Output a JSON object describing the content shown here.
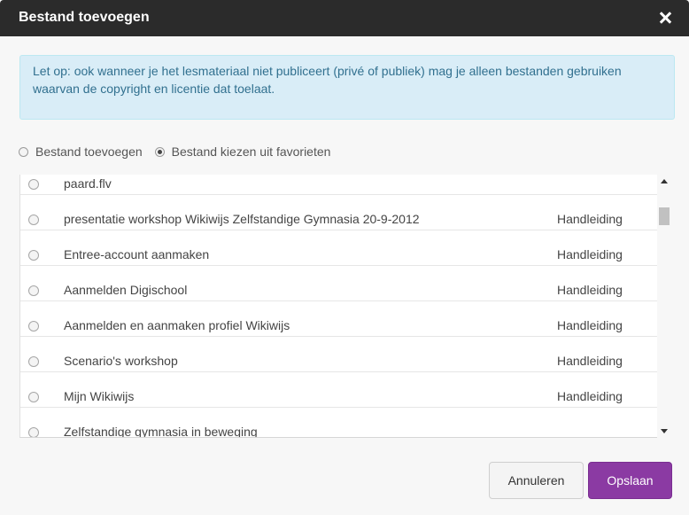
{
  "dialog": {
    "title": "Bestand toevoegen",
    "alert_text": "Let op: ook wanneer je het lesmateriaal niet publiceert (privé of publiek) mag je alleen bestanden gebruiken waarvan de copyright en licentie dat toelaat.",
    "radio_add_label": "Bestand toevoegen",
    "radio_favorites_label": "Bestand kiezen uit favorieten",
    "selected_source": "favorites",
    "rows": [
      {
        "name": "paard.flv",
        "type": ""
      },
      {
        "name": "presentatie workshop Wikiwijs Zelfstandige Gymnasia 20-9-2012",
        "type": "Handleiding"
      },
      {
        "name": "Entree-account aanmaken",
        "type": "Handleiding"
      },
      {
        "name": "Aanmelden Digischool",
        "type": "Handleiding"
      },
      {
        "name": "Aanmelden en aanmaken profiel Wikiwijs",
        "type": "Handleiding"
      },
      {
        "name": "Scenario's workshop",
        "type": "Handleiding"
      },
      {
        "name": "Mijn Wikiwijs",
        "type": "Handleiding"
      },
      {
        "name": "Zelfstandige gymnasia in beweging",
        "type": ""
      },
      {
        "name": "",
        "type": ""
      }
    ],
    "cancel_label": "Annuleren",
    "save_label": "Opslaan",
    "colors": {
      "header": "#2b2b2b",
      "alert_bg": "#d9edf7",
      "alert_text": "#31708f",
      "save_button": "#8b3aa3"
    }
  }
}
